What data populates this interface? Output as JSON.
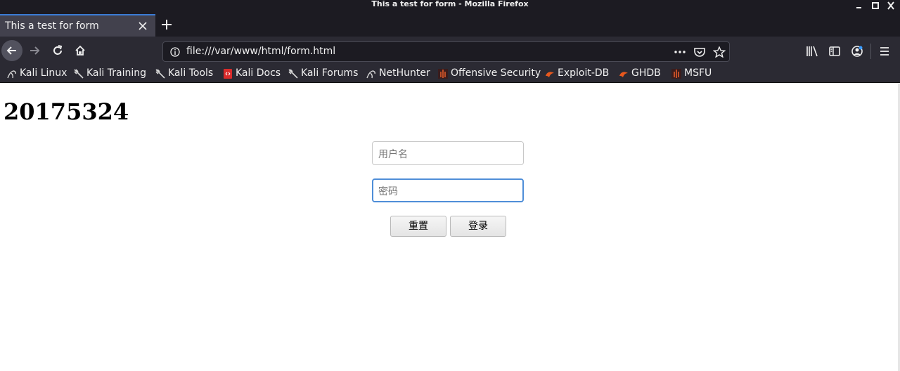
{
  "window": {
    "title": "This a test for form - Mozilla Firefox"
  },
  "tab": {
    "title": "This a test for form"
  },
  "urlbar": {
    "url": "file:///var/www/html/form.html"
  },
  "bookmarks": [
    {
      "label": "Kali Linux",
      "icon": "kali-dragon-icon"
    },
    {
      "label": "Kali Training",
      "icon": "kali-dragon-icon"
    },
    {
      "label": "Kali Tools",
      "icon": "kali-dragon-icon"
    },
    {
      "label": "Kali Docs",
      "icon": "kali-docs-icon"
    },
    {
      "label": "Kali Forums",
      "icon": "kali-dragon-icon"
    },
    {
      "label": "NetHunter",
      "icon": "nethunter-icon"
    },
    {
      "label": "Offensive Security",
      "icon": "offsec-icon"
    },
    {
      "label": "Exploit-DB",
      "icon": "exploit-db-icon"
    },
    {
      "label": "GHDB",
      "icon": "ghdb-icon"
    },
    {
      "label": "MSFU",
      "icon": "offsec-icon"
    }
  ],
  "page": {
    "heading": "20175324",
    "username_placeholder": "用户名",
    "password_placeholder": "密码",
    "reset_label": "重置",
    "login_label": "登录"
  },
  "colors": {
    "chrome_dark": "#1c1b22",
    "toolbar": "#2b2a33",
    "tab_active": "#42414d",
    "tab_accent": "#3a7bd5",
    "focus_ring": "#4f8ed8"
  }
}
